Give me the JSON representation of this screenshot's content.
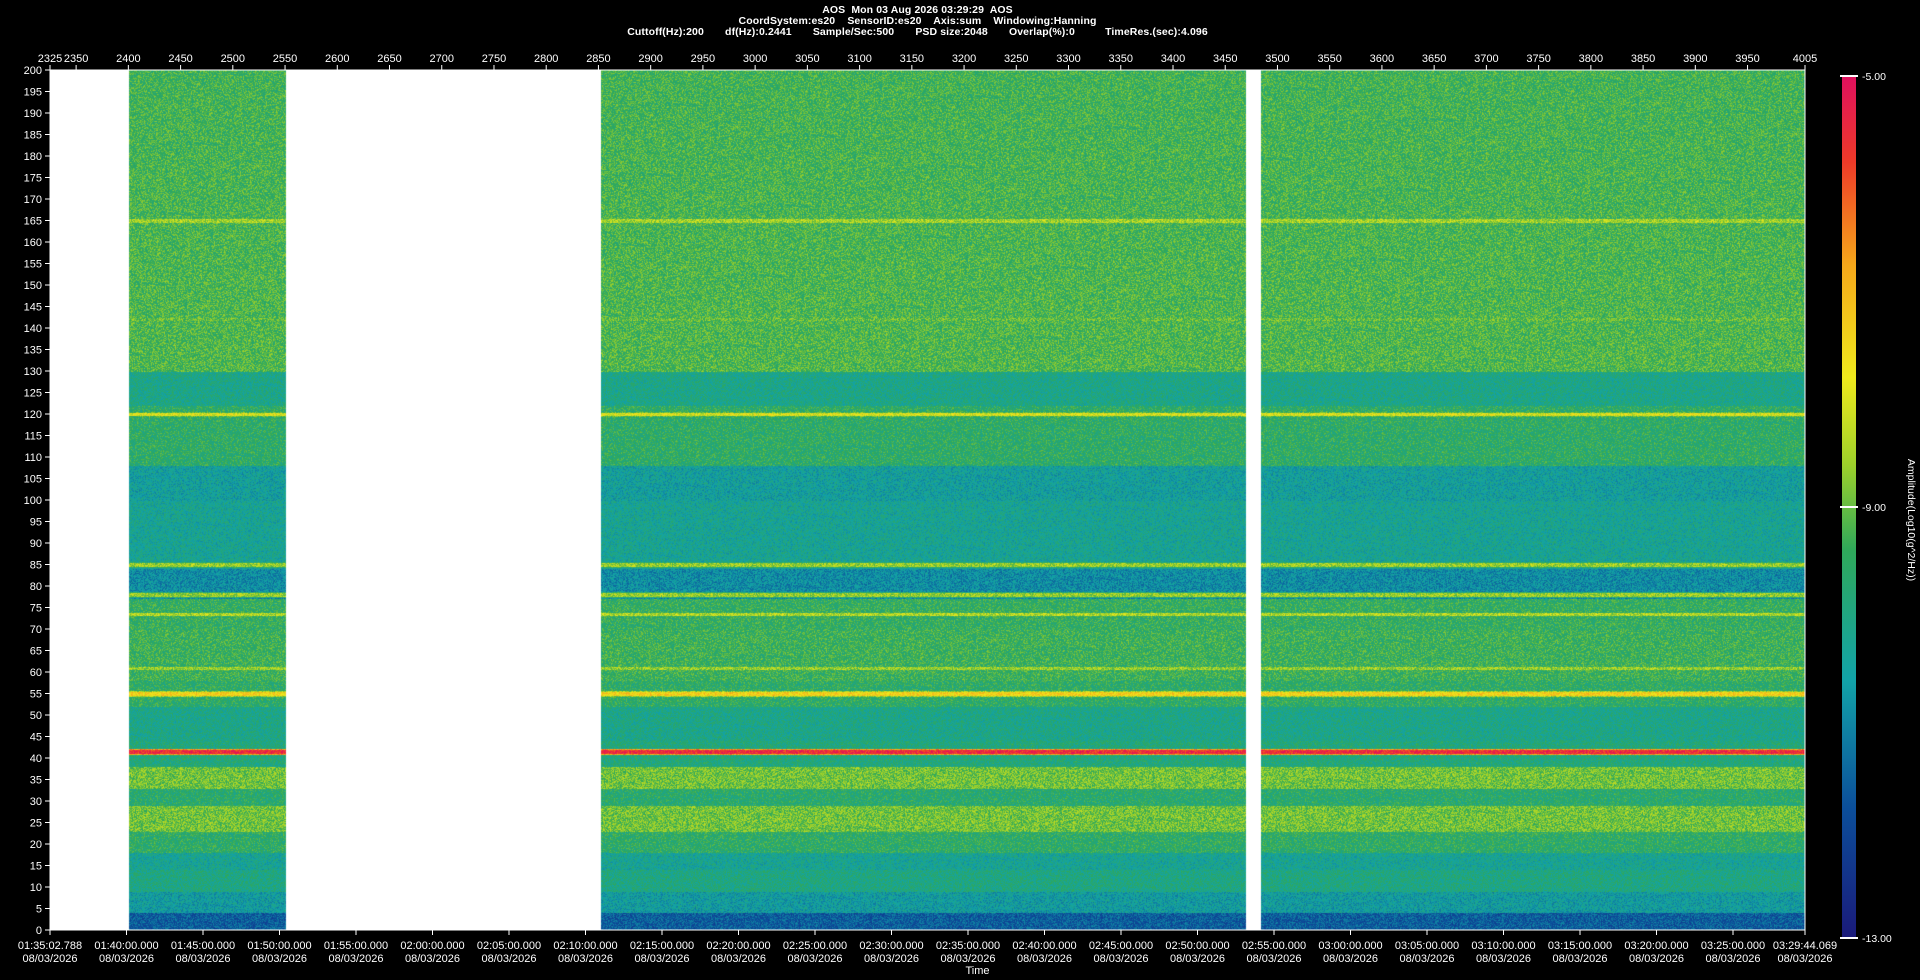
{
  "header": {
    "line1": "AOS  Mon 03 Aug 2026 03:29:29  AOS",
    "line2": "CoordSystem:es20    SensorID:es20    Axis:sum    Windowing:Hanning",
    "line3": "Cuttoff(Hz):200       df(Hz):0.2441       Sample/Sec:500       PSD size:2048       Overlap(%):0          TimeRes.(sec):4.096"
  },
  "chart_data": {
    "type": "heatmap",
    "xlabel": "Time",
    "colorbar_label": "Amplitude(Log10(g^2/Hz))",
    "colorbar_ticks": [
      "-5.00",
      "-9.00",
      "-13.00"
    ],
    "colorbar_range": [
      -13,
      -5
    ],
    "top_axis": {
      "range": [
        2325,
        4005
      ],
      "ticks": [
        2325,
        2350,
        2400,
        2450,
        2500,
        2550,
        2600,
        2650,
        2700,
        2750,
        2800,
        2850,
        2900,
        2950,
        3000,
        3050,
        3100,
        3150,
        3200,
        3250,
        3300,
        3350,
        3400,
        3450,
        3500,
        3550,
        3600,
        3650,
        3700,
        3750,
        3800,
        3850,
        3900,
        3950,
        4005
      ]
    },
    "y_axis": {
      "range": [
        0,
        200
      ],
      "ticks": [
        0,
        5,
        10,
        15,
        20,
        25,
        30,
        35,
        40,
        45,
        50,
        55,
        60,
        65,
        70,
        75,
        80,
        85,
        90,
        95,
        100,
        105,
        110,
        115,
        120,
        125,
        130,
        135,
        140,
        145,
        150,
        155,
        160,
        165,
        170,
        175,
        180,
        185,
        190,
        195,
        200
      ]
    },
    "bottom_axis": {
      "ticks": [
        {
          "time": "01:35:02.788",
          "date": "08/03/2026"
        },
        {
          "time": "01:40:00.000",
          "date": "08/03/2026"
        },
        {
          "time": "01:45:00.000",
          "date": "08/03/2026"
        },
        {
          "time": "01:50:00.000",
          "date": "08/03/2026"
        },
        {
          "time": "01:55:00.000",
          "date": "08/03/2026"
        },
        {
          "time": "02:00:00.000",
          "date": "08/03/2026"
        },
        {
          "time": "02:05:00.000",
          "date": "08/03/2026"
        },
        {
          "time": "02:10:00.000",
          "date": "08/03/2026"
        },
        {
          "time": "02:15:00.000",
          "date": "08/03/2026"
        },
        {
          "time": "02:20:00.000",
          "date": "08/03/2026"
        },
        {
          "time": "02:25:00.000",
          "date": "08/03/2026"
        },
        {
          "time": "02:30:00.000",
          "date": "08/03/2026"
        },
        {
          "time": "02:35:00.000",
          "date": "08/03/2026"
        },
        {
          "time": "02:40:00.000",
          "date": "08/03/2026"
        },
        {
          "time": "02:45:00.000",
          "date": "08/03/2026"
        },
        {
          "time": "02:50:00.000",
          "date": "08/03/2026"
        },
        {
          "time": "02:55:00.000",
          "date": "08/03/2026"
        },
        {
          "time": "03:00:00.000",
          "date": "08/03/2026"
        },
        {
          "time": "03:05:00.000",
          "date": "08/03/2026"
        },
        {
          "time": "03:10:00.000",
          "date": "08/03/2026"
        },
        {
          "time": "03:15:00.000",
          "date": "08/03/2026"
        },
        {
          "time": "03:20:00.000",
          "date": "08/03/2026"
        },
        {
          "time": "03:25:00.000",
          "date": "08/03/2026"
        },
        {
          "time": "03:29:44.069",
          "date": "08/03/2026"
        }
      ]
    },
    "data_segments": [
      {
        "start": 2400,
        "end": 2550
      },
      {
        "start": 2852,
        "end": 3469
      },
      {
        "start": 3484,
        "end": 4005
      }
    ],
    "spectral_lines": [
      {
        "freq": 85,
        "level": -8.6
      },
      {
        "freq": 78,
        "level": -8.6
      },
      {
        "freq": 73.5,
        "level": -8.4
      },
      {
        "freq": 61,
        "level": -8.6
      },
      {
        "freq": 55,
        "level": -7.4
      },
      {
        "freq": 41.5,
        "level": -5.5
      },
      {
        "freq": 120,
        "level": -8.0
      },
      {
        "freq": 165,
        "level": -8.5
      },
      {
        "freq": 142,
        "level": -9.0
      }
    ]
  }
}
